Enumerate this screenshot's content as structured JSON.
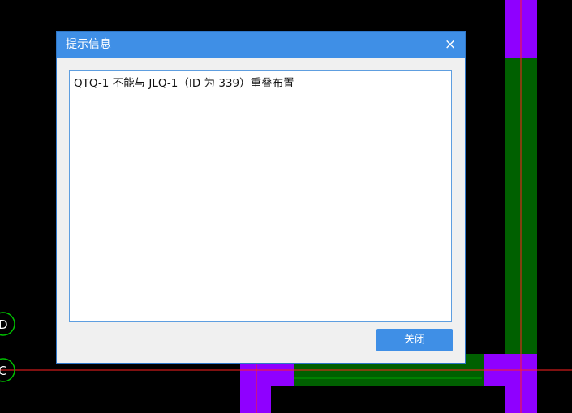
{
  "dialog": {
    "title": "提示信息",
    "close_icon": "×",
    "message": "QTQ-1 不能与 JLQ-1（ID 为 339）重叠布置",
    "close_button_label": "关闭"
  },
  "axes": {
    "axis_d_label": "D",
    "axis_c_label": "C"
  },
  "colors": {
    "background": "#000000",
    "wall_purple": "#8f00ff",
    "wall_green": "#006000",
    "axis_line": "#ff0000",
    "axis_bubble": "#00c000",
    "dialog_accent": "#3f8fe6"
  }
}
